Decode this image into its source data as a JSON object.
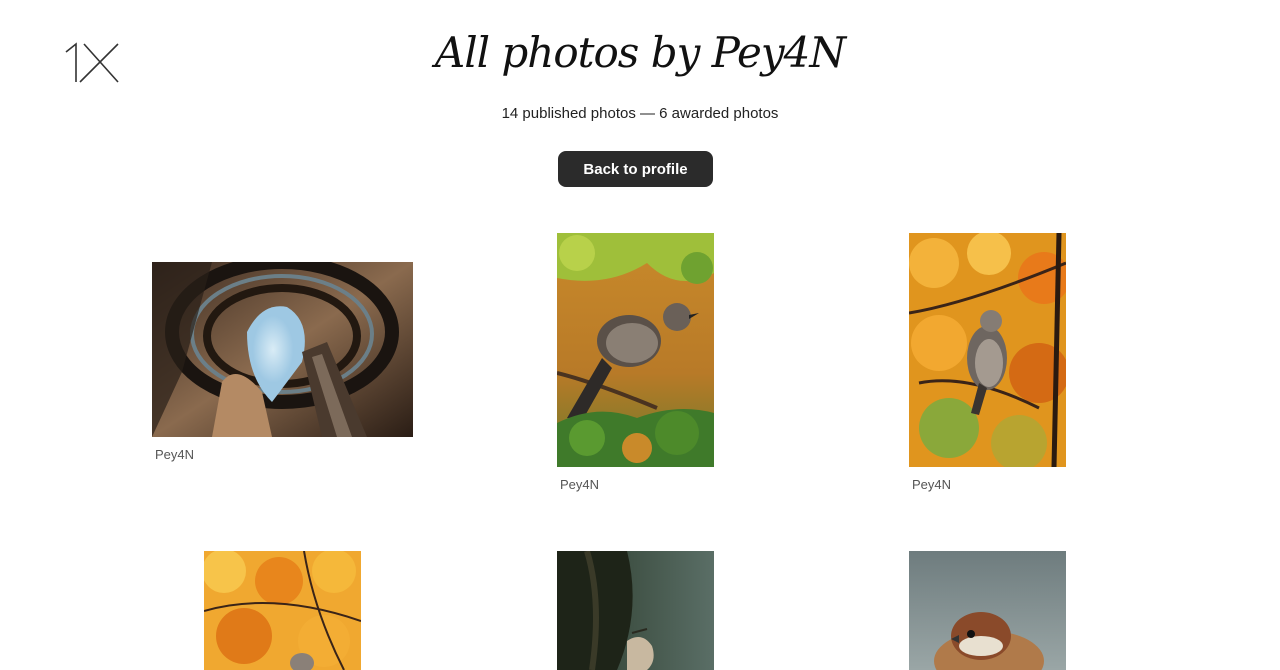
{
  "header": {
    "logo_icon": "1x-logo-icon",
    "title": "All photos by Pey4N",
    "subtitle": "14 published photos — 6 awarded photos",
    "back_label": "Back to profile"
  },
  "photos": [
    {
      "author": "Pey4N",
      "subject": "architecture-spiral"
    },
    {
      "author": "Pey4N",
      "subject": "bird-on-branch-green"
    },
    {
      "author": "Pey4N",
      "subject": "bird-autumn-leaves"
    },
    {
      "author": "",
      "subject": "autumn-leaves"
    },
    {
      "author": "",
      "subject": "bird-tree-trunk"
    },
    {
      "author": "",
      "subject": "sparrow"
    }
  ],
  "colors": {
    "button_bg": "#2b2b2b",
    "button_text": "#ffffff",
    "background": "#ffffff"
  }
}
